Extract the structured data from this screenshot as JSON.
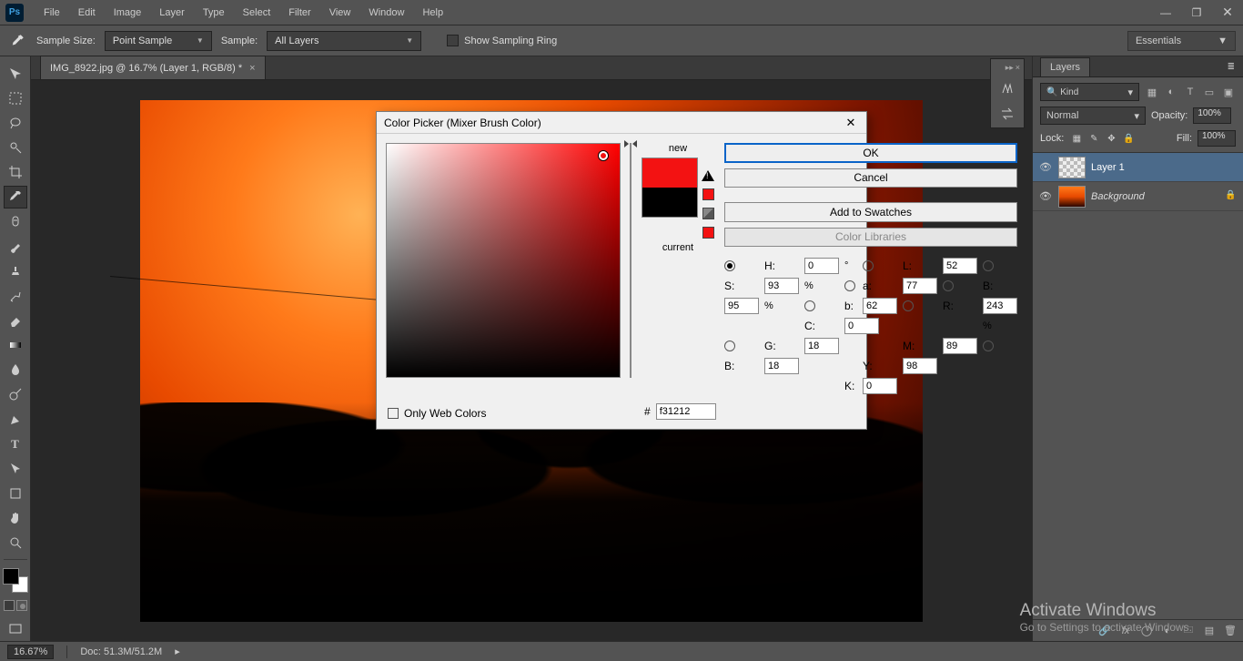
{
  "app": {
    "logo_text": "Ps"
  },
  "menu": [
    "File",
    "Edit",
    "Image",
    "Layer",
    "Type",
    "Select",
    "Filter",
    "View",
    "Window",
    "Help"
  ],
  "options": {
    "sample_size_label": "Sample Size:",
    "sample_size_value": "Point Sample",
    "sample_label": "Sample:",
    "sample_value": "All Layers",
    "show_sampling_ring": "Show Sampling Ring",
    "workspace": "Essentials"
  },
  "document": {
    "tab_title": "IMG_8922.jpg @ 16.7% (Layer 1, RGB/8) *"
  },
  "layers_panel": {
    "tab": "Layers",
    "kind_label": "Kind",
    "blend_mode": "Normal",
    "opacity_label": "Opacity:",
    "opacity_value": "100%",
    "lock_label": "Lock:",
    "fill_label": "Fill:",
    "fill_value": "100%",
    "items": [
      {
        "name": "Layer 1",
        "locked": false,
        "selected": true,
        "thumb": "checker"
      },
      {
        "name": "Background",
        "locked": true,
        "selected": false,
        "thumb": "bg",
        "italic": true
      }
    ]
  },
  "status": {
    "zoom": "16.67%",
    "doc_info": "Doc: 51.3M/51.2M"
  },
  "color_picker": {
    "title": "Color Picker (Mixer Brush Color)",
    "new_label": "new",
    "current_label": "current",
    "ok": "OK",
    "cancel": "Cancel",
    "add_swatches": "Add to Swatches",
    "color_libraries": "Color Libraries",
    "only_web": "Only Web Colors",
    "hex_label": "#",
    "hex_value": "f31212",
    "fields": {
      "H": {
        "v": "0",
        "u": "°"
      },
      "S": {
        "v": "93",
        "u": "%"
      },
      "B": {
        "v": "95",
        "u": "%"
      },
      "R": {
        "v": "243",
        "u": ""
      },
      "G": {
        "v": "18",
        "u": ""
      },
      "Bc": {
        "v": "18",
        "u": ""
      },
      "L": {
        "v": "52",
        "u": ""
      },
      "a": {
        "v": "77",
        "u": ""
      },
      "b": {
        "v": "62",
        "u": ""
      },
      "C": {
        "v": "0",
        "u": "%"
      },
      "M": {
        "v": "89",
        "u": "%"
      },
      "Y": {
        "v": "98",
        "u": "%"
      },
      "K": {
        "v": "0",
        "u": "%"
      }
    },
    "selected_radio": "H"
  },
  "watermark": {
    "line1": "Activate Windows",
    "line2": "Go to Settings to activate Windows."
  }
}
